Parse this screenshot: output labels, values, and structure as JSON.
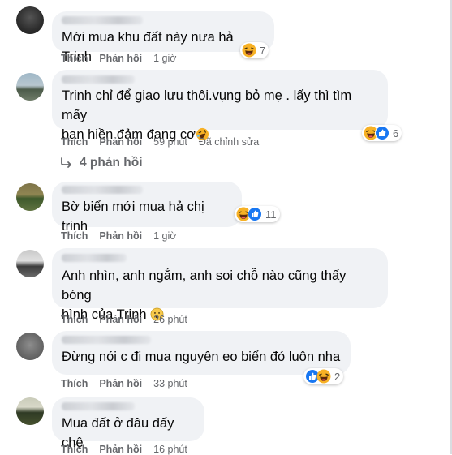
{
  "labels": {
    "like": "Thích",
    "reply": "Phản hồi"
  },
  "comments": [
    {
      "text": "Mới mua khu đất này nưa hả Trinh",
      "time": "1 giờ",
      "reactions": "7",
      "reaction_icons": [
        "haha-icon"
      ]
    },
    {
      "text_line1": "Trinh chỉ để giao lưu thôi.vụng bỏ mẹ . lấy thì tìm mấy",
      "text_line2": "bạn hiền đảm đang cơ",
      "time": "59 phút",
      "edited": "Đã chỉnh sửa",
      "reactions": "6",
      "reaction_icons": [
        "haha-icon",
        "like-icon"
      ]
    },
    {
      "text": "Bờ biển mới mua hả chị trinh",
      "time": "1 giờ",
      "reactions": "11",
      "reaction_icons": [
        "haha-icon",
        "like-icon"
      ]
    },
    {
      "text_line1": "Anh nhìn, anh ngắm, anh soi chỗ nào cũng thấy bóng",
      "text_line2": "hình của Trinh",
      "time": "26 phút"
    },
    {
      "text": "Đừng nói c đi mua nguyên eo biển đó luôn nha",
      "time": "33 phút",
      "reactions": "2",
      "reaction_icons": [
        "like-icon",
        "haha-icon"
      ]
    },
    {
      "text": "Mua đất ở đâu đấy chệ",
      "time": "16 phút"
    }
  ],
  "replies_link": "4 phản hồi",
  "colors": {
    "bubble": "#f0f2f5",
    "meta": "#65676b",
    "text": "#050505",
    "like_blue": "#1877f2",
    "haha_yellow": "#f7b125"
  }
}
